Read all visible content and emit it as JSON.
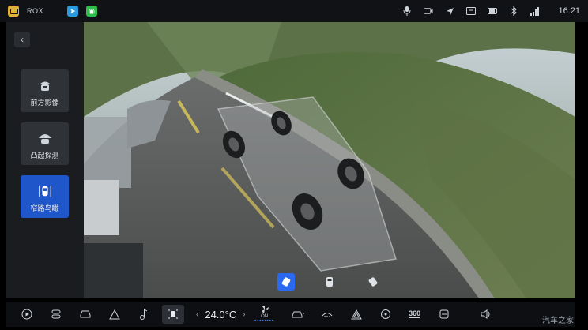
{
  "status_bar": {
    "brand": "ROX",
    "time": "16:21",
    "icons": [
      "microphone-icon",
      "camera-icon",
      "navigation-icon",
      "message-icon",
      "battery-icon",
      "bluetooth-icon",
      "wifi-icon"
    ]
  },
  "left_panel": {
    "back_icon": "chevron-left-icon",
    "modes": [
      {
        "label": "前方影像",
        "icon": "front-camera-icon",
        "active": false
      },
      {
        "label": "凸起探测",
        "icon": "bump-detect-icon",
        "active": false
      },
      {
        "label": "窄路鸟瞰",
        "icon": "narrow-road-icon",
        "active": true
      }
    ]
  },
  "camera_tools": [
    {
      "icon": "transparent-chassis-icon",
      "active": true
    },
    {
      "icon": "car-side-icon",
      "active": false
    },
    {
      "icon": "car-rotate-icon",
      "active": false
    }
  ],
  "dock": {
    "temperature": "24.0°C",
    "fan_label": "ON",
    "badge_360": "360",
    "icons": [
      "play-icon",
      "layers-icon",
      "car-icon",
      "warning-icon",
      "music-icon",
      "panorama-icon",
      "fan-icon",
      "car-air-icon",
      "heat-icon",
      "hazard-icon",
      "steering-heat-icon",
      "seat-heat-icon",
      "volume-icon"
    ]
  },
  "watermark": "汽车之家",
  "colors": {
    "accent": "#1f56c9",
    "panel": "#1a1c20",
    "dock": "#0d0f12"
  }
}
